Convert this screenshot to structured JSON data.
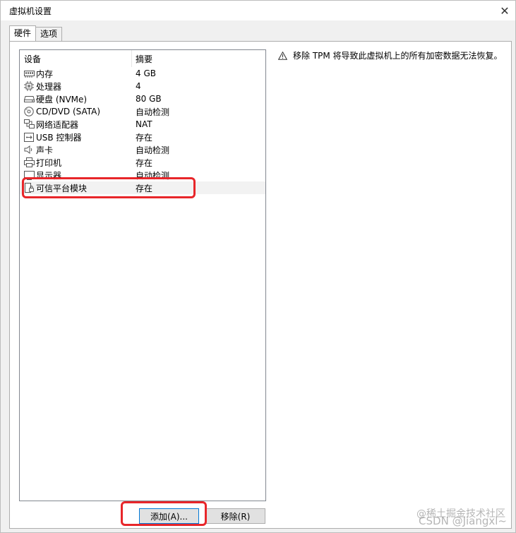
{
  "window": {
    "title": "虚拟机设置",
    "close_glyph": "✕"
  },
  "tabs": [
    {
      "label": "硬件",
      "active": true
    },
    {
      "label": "选项",
      "active": false
    }
  ],
  "device_list": {
    "headers": {
      "device": "设备",
      "summary": "摘要"
    },
    "rows": [
      {
        "icon": "memory-icon",
        "device": "内存",
        "summary": "4 GB"
      },
      {
        "icon": "processor-icon",
        "device": "处理器",
        "summary": "4"
      },
      {
        "icon": "hard-disk-icon",
        "device": "硬盘 (NVMe)",
        "summary": "80 GB"
      },
      {
        "icon": "cd-dvd-icon",
        "device": "CD/DVD (SATA)",
        "summary": "自动检测"
      },
      {
        "icon": "network-adapter-icon",
        "device": "网络适配器",
        "summary": "NAT"
      },
      {
        "icon": "usb-controller-icon",
        "device": "USB 控制器",
        "summary": "存在"
      },
      {
        "icon": "sound-card-icon",
        "device": "声卡",
        "summary": "自动检测"
      },
      {
        "icon": "printer-icon",
        "device": "打印机",
        "summary": "存在"
      },
      {
        "icon": "display-icon",
        "device": "显示器",
        "summary": "自动检测"
      },
      {
        "icon": "tpm-icon",
        "device": "可信平台模块",
        "summary": "存在",
        "selected": true
      }
    ]
  },
  "buttons": {
    "add": "添加(A)...",
    "remove": "移除(R)"
  },
  "warning": {
    "icon": "warning-icon",
    "text": "移除 TPM 将导致此虚拟机上的所有加密数据无法恢复。"
  },
  "annotation_color": "#e8262a",
  "watermark": {
    "line1": "@稀土掘金技术社区",
    "line2": "CSDN @Jiangxl~"
  }
}
